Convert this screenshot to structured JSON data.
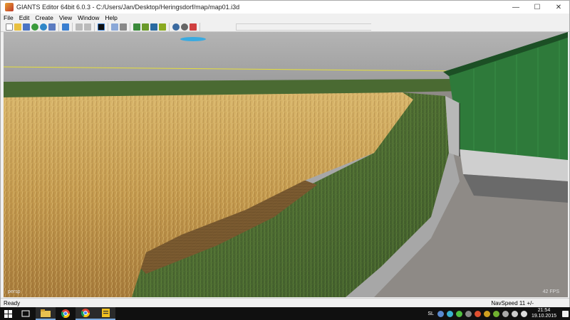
{
  "window": {
    "title": "GIANTS Editor 64bit 6.0.3 - C:/Users/Jan/Desktop/Heringsdorf/map/map01.i3d",
    "minimize_glyph": "—",
    "maximize_glyph": "☐",
    "close_glyph": "✕"
  },
  "menu": {
    "items": [
      {
        "label": "File"
      },
      {
        "label": "Edit"
      },
      {
        "label": "Create"
      },
      {
        "label": "View"
      },
      {
        "label": "Window"
      },
      {
        "label": "Help"
      }
    ]
  },
  "toolbar": {
    "icons": [
      "new-file-icon",
      "open-file-icon",
      "save-icon",
      "refresh-icon",
      "reload-icon",
      "export-icon",
      "undo-arrow-icon",
      "redo-icon",
      "redo-alt-icon",
      "stop-icon",
      "select-icon",
      "pin-icon",
      "terrain-paint-icon",
      "foliage-paint-icon",
      "paint-tool-icon",
      "brush-icon",
      "transform-icon",
      "settings-icon",
      "delete-icon"
    ]
  },
  "viewport": {
    "camera_label": "persp",
    "fps_label": "42 FPS",
    "colors": {
      "sky": "#a8a8a8",
      "wheat": "#c9a45c",
      "grass": "#4e6b35",
      "barn_roof": "#2f7a3a",
      "barn_wall": "#bfbfbf",
      "gravel": "#8f8a85",
      "horizon_line": "#e6df3a"
    }
  },
  "status": {
    "left": "Ready",
    "right": "NavSpeed 11 +/-"
  },
  "taskbar": {
    "tray_label": "SL",
    "time": "21:54",
    "date": "19.10.2015"
  }
}
